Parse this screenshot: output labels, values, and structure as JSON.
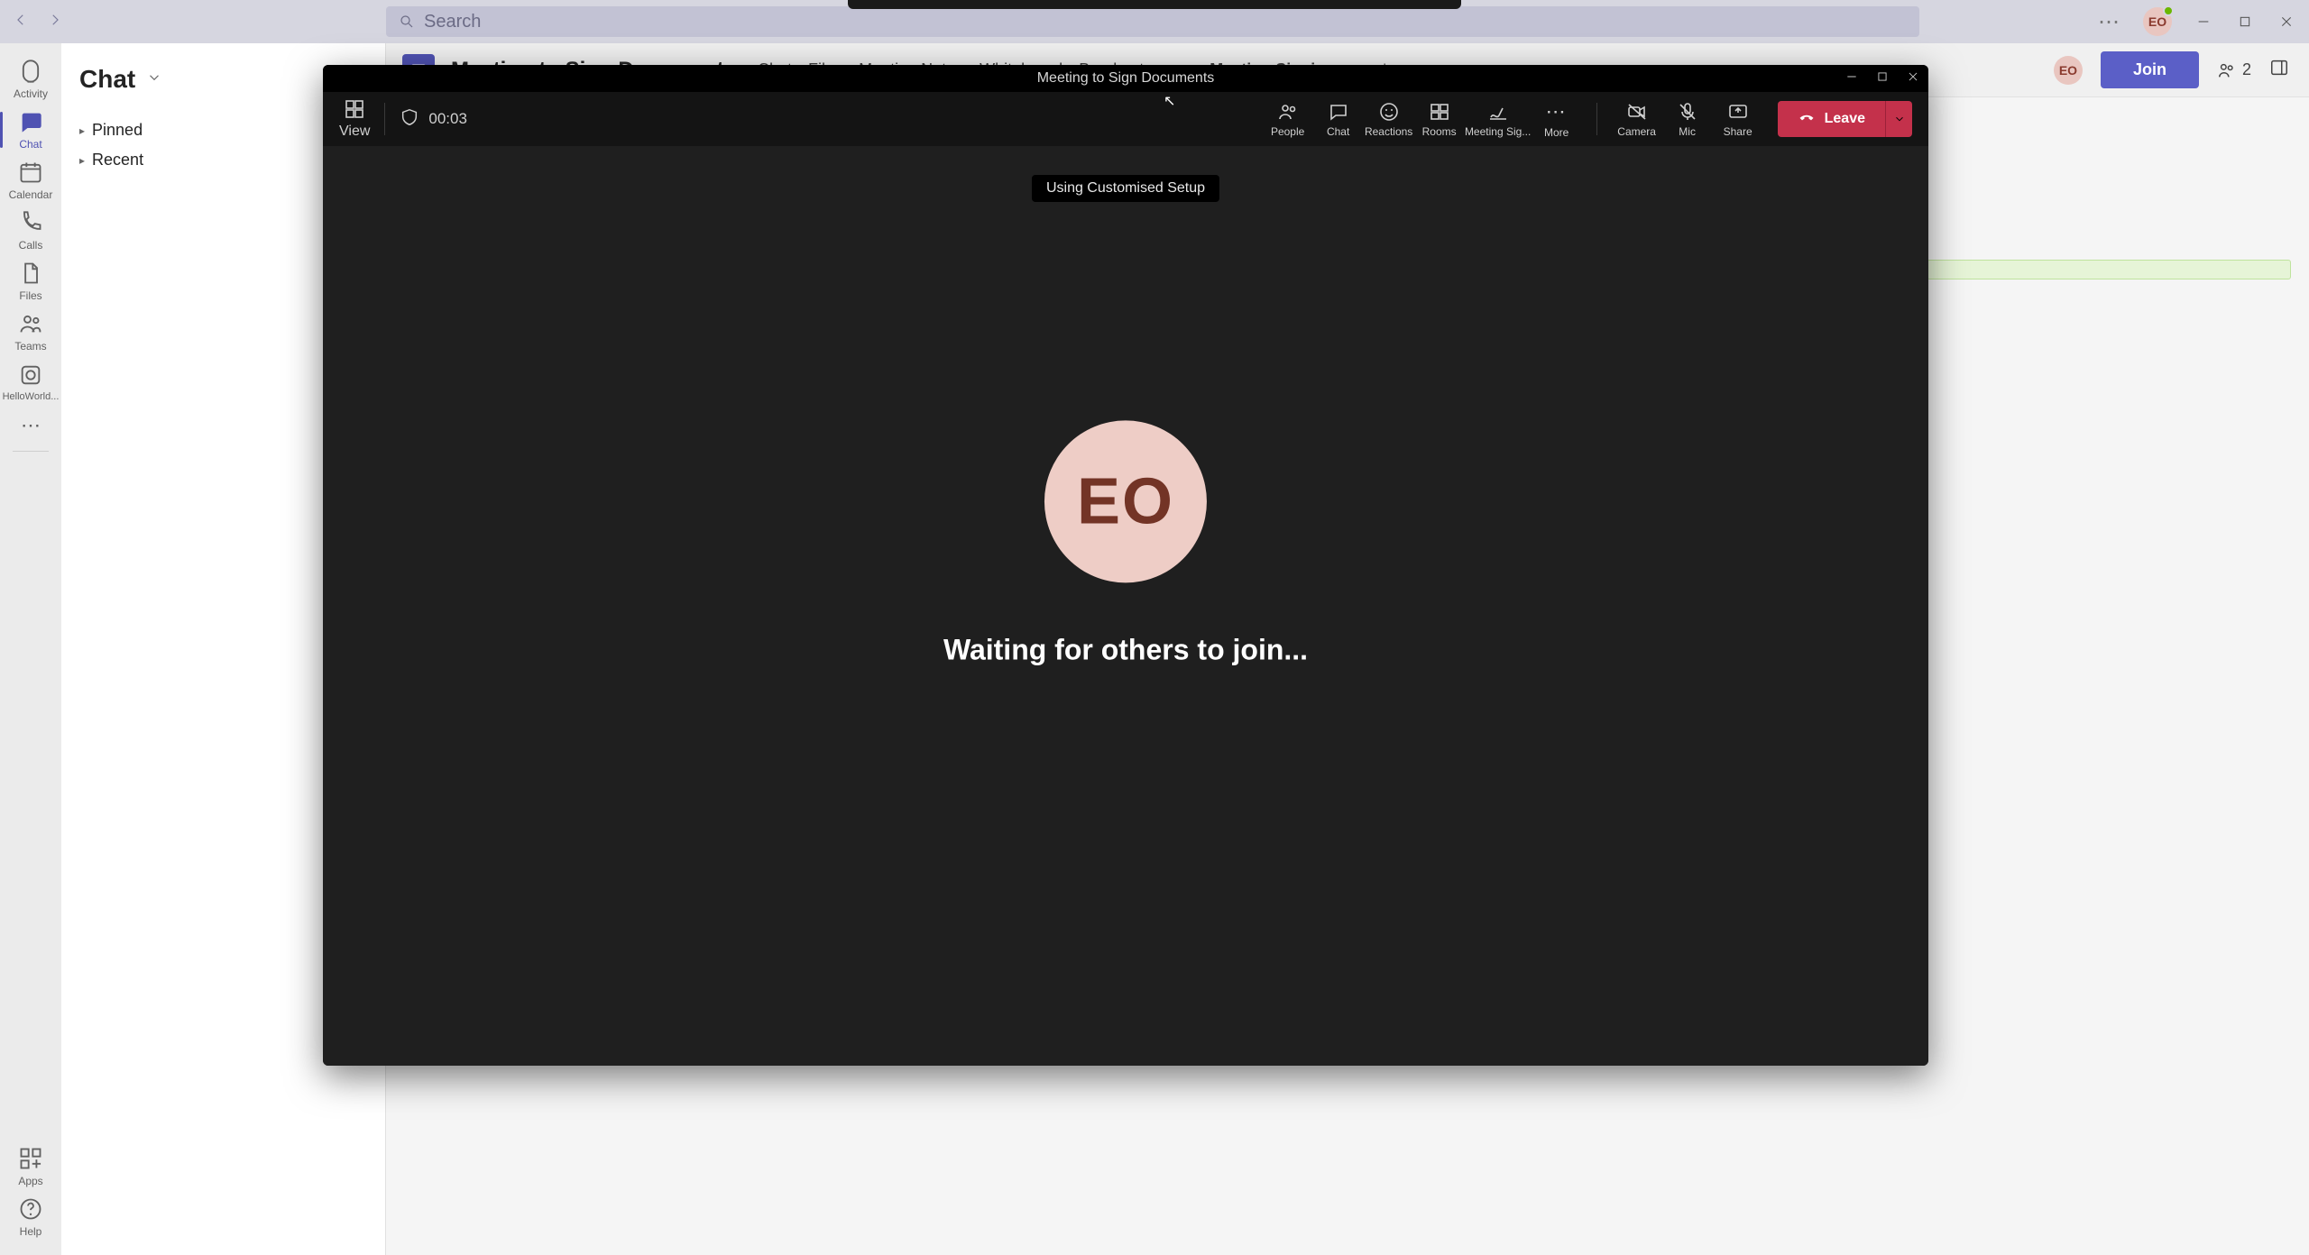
{
  "title_bar": {
    "search_placeholder": "Search",
    "avatar_initials": "EO"
  },
  "app_rail": {
    "items": [
      {
        "label": "Activity"
      },
      {
        "label": "Chat"
      },
      {
        "label": "Calendar"
      },
      {
        "label": "Calls"
      },
      {
        "label": "Files"
      },
      {
        "label": "Teams"
      },
      {
        "label": "HelloWorld..."
      }
    ],
    "bottom": [
      {
        "label": "Apps"
      },
      {
        "label": "Help"
      }
    ]
  },
  "chat_panel": {
    "title": "Chat",
    "sections": [
      {
        "label": "Pinned"
      },
      {
        "label": "Recent"
      }
    ]
  },
  "tabs_bar": {
    "meeting_title": "Meeting to Sign Documents",
    "tabs": [
      {
        "label": "Chat"
      },
      {
        "label": "Files"
      },
      {
        "label": "Meeting Notes"
      },
      {
        "label": "Whiteboard"
      },
      {
        "label": "Breakout rooms"
      },
      {
        "label": "Meeting Signing"
      }
    ],
    "avatar_initials": "EO",
    "join_label": "Join",
    "participant_count": "2"
  },
  "meeting_window": {
    "title": "Meeting to Sign Documents",
    "view_label": "View",
    "elapsed": "00:03",
    "toolbar": {
      "people": "People",
      "chat": "Chat",
      "reactions": "Reactions",
      "rooms": "Rooms",
      "meeting_sig": "Meeting Sig...",
      "more": "More",
      "camera": "Camera",
      "mic": "Mic",
      "share": "Share",
      "leave": "Leave"
    },
    "banner": "Using Customised Setup",
    "avatar_initials": "EO",
    "waiting_text": "Waiting for others to join..."
  }
}
